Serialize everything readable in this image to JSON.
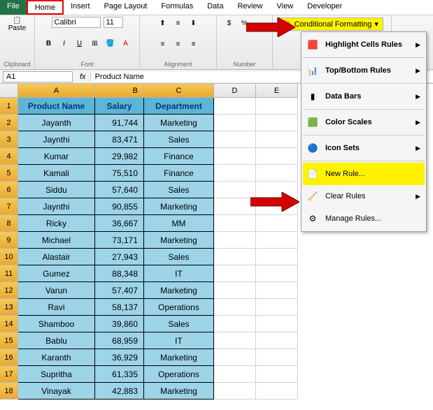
{
  "tabs": {
    "file": "File",
    "home": "Home",
    "insert": "Insert",
    "page": "Page Layout",
    "formulas": "Formulas",
    "data": "Data",
    "review": "Review",
    "view": "View",
    "developer": "Developer"
  },
  "ribbon": {
    "paste": "Paste",
    "clipboard": "Clipboard",
    "font": "Font",
    "alignment": "Alignment",
    "number": "Number",
    "fontName": "Calibri",
    "fontSize": "11",
    "condFmt": "Conditional Formatting"
  },
  "namebox": "A1",
  "formula": "Product Name",
  "cols": [
    "A",
    "B",
    "C",
    "D",
    "E"
  ],
  "chart_data": {
    "type": "table",
    "headers": [
      "Product Name",
      "Salary",
      "Department"
    ],
    "rows": [
      [
        "Jayanth",
        "91,744",
        "Marketing"
      ],
      [
        "Jaynthi",
        "83,471",
        "Sales"
      ],
      [
        "Kumar",
        "29,982",
        "Finance"
      ],
      [
        "Kamali",
        "75,510",
        "Finance"
      ],
      [
        "Siddu",
        "57,640",
        "Sales"
      ],
      [
        "Jaynthi",
        "90,855",
        "Marketing"
      ],
      [
        "Ricky",
        "36,667",
        "MM"
      ],
      [
        "Michael",
        "73,171",
        "Marketing"
      ],
      [
        "Alastair",
        "27,943",
        "Sales"
      ],
      [
        "Gumez",
        "88,348",
        "IT"
      ],
      [
        "Varun",
        "57,407",
        "Marketing"
      ],
      [
        "Ravi",
        "58,137",
        "Operations"
      ],
      [
        "Shamboo",
        "39,860",
        "Sales"
      ],
      [
        "Bablu",
        "68,959",
        "IT"
      ],
      [
        "Karanth",
        "36,929",
        "Marketing"
      ],
      [
        "Supritha",
        "61,335",
        "Operations"
      ],
      [
        "Vinayak",
        "42,883",
        "Marketing"
      ]
    ]
  },
  "menu": {
    "highlight": "Highlight Cells Rules",
    "topbottom": "Top/Bottom Rules",
    "databars": "Data Bars",
    "colorscales": "Color Scales",
    "iconsets": "Icon Sets",
    "newrule": "New Rule...",
    "clearrules": "Clear Rules",
    "managerules": "Manage Rules..."
  }
}
